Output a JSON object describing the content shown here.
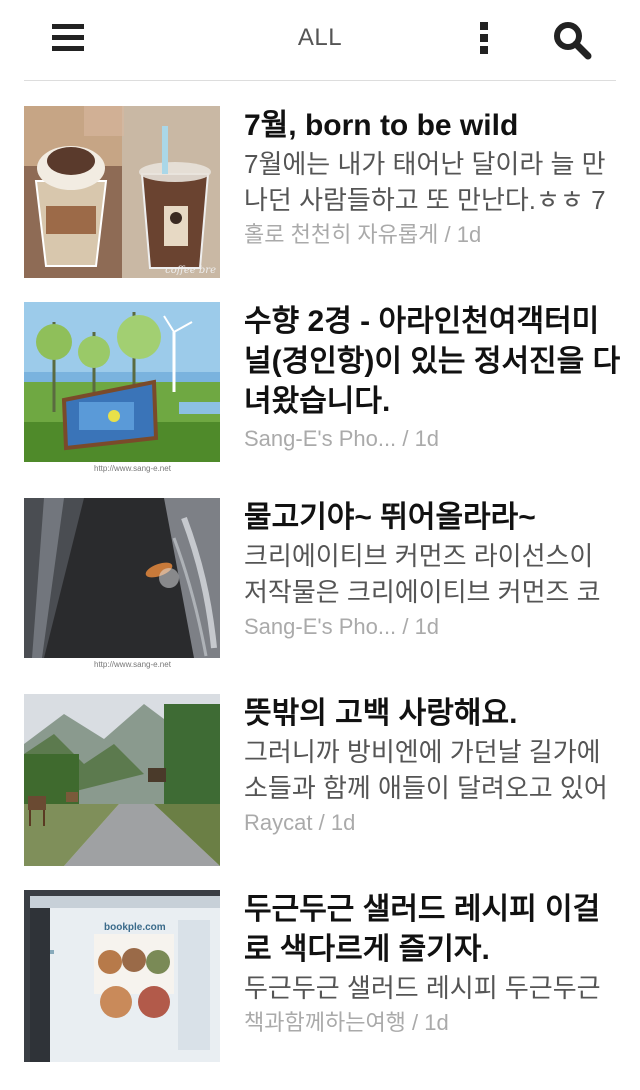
{
  "header": {
    "title": "ALL",
    "menu_icon": "hamburger-menu-icon",
    "more_icon": "vertical-dots-icon",
    "search_icon": "search-icon"
  },
  "items": [
    {
      "headline": "7월, born to be wild",
      "snippet": "7월에는 내가 태어난 달이라 늘 만나던 사람들하고 또 만난다.ㅎㅎ 7",
      "source": "홀로 천천히 자유롭게",
      "age": "1d",
      "thumb_caption": "coffee bre"
    },
    {
      "headline": "수향 2경 - 아라인천여객터미널(경인항)이 있는 정서진을 다녀왔습니다.",
      "snippet": "",
      "source": "Sang-E's Pho...",
      "age": "1d",
      "thumb_caption": "http://www.sang-e.net"
    },
    {
      "headline": "물고기야~ 뛰어올라라~",
      "snippet": "크리에이티브 커먼즈 라이선스이 저작물은 크리에이티브 커먼즈 코",
      "source": "Sang-E's Pho...",
      "age": "1d",
      "thumb_caption": "http://www.sang-e.net"
    },
    {
      "headline": "뜻밖의 고백 사랑해요.",
      "snippet": "그러니까 방비엔에 가던날 길가에 소들과 함께 애들이 달려오고 있어",
      "source": "Raycat",
      "age": "1d",
      "thumb_caption": ""
    },
    {
      "headline": "두근두근 샐러드 레시피 이걸로 색다르게 즐기자.",
      "snippet": "두근두근 샐러드 레시피 두근두근",
      "source": "책과함께하는여행",
      "age": "1d",
      "thumb_caption": "bookple.com"
    }
  ]
}
